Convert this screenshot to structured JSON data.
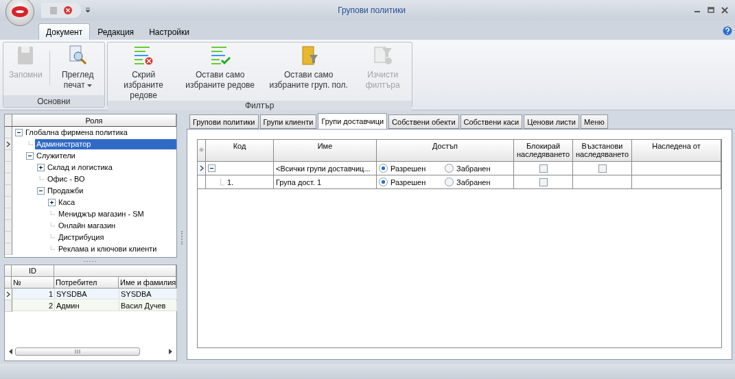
{
  "window": {
    "title": "Групови политики"
  },
  "ribbon_tabs": [
    {
      "label": "Документ",
      "selected": true
    },
    {
      "label": "Редакция",
      "selected": false
    },
    {
      "label": "Настройки",
      "selected": false
    }
  ],
  "ribbon_groups": [
    {
      "label": "Основни",
      "buttons": [
        {
          "kind": "save",
          "label": "Запомни",
          "disabled": true,
          "menu": false
        },
        {
          "kind": "preview",
          "label": "Преглед печат",
          "disabled": false,
          "menu": true
        }
      ]
    },
    {
      "label": "Филтър",
      "buttons": [
        {
          "kind": "hide-rows",
          "label": "Скрий избраните редове",
          "disabled": false,
          "menu": false
        },
        {
          "kind": "keep-rows",
          "label": "Остави само избраните редове",
          "disabled": false,
          "menu": false
        },
        {
          "kind": "keep-groups",
          "label": "Остави само избраните груп. пол.",
          "disabled": false,
          "menu": false
        },
        {
          "kind": "clear-filter",
          "label": "Изчисти филтъра",
          "disabled": true,
          "menu": false
        }
      ]
    }
  ],
  "roles": {
    "column": "Роля",
    "items": [
      {
        "label": "Глобална фирмена политика",
        "selected": false,
        "expanded": true,
        "children": [
          {
            "label": "Администратор",
            "selected": true
          },
          {
            "label": "Служители",
            "selected": false,
            "expanded": true,
            "children": [
              {
                "label": "Склад и логистика",
                "selected": false,
                "expanded": false
              },
              {
                "label": "Офис - ВО",
                "selected": false
              },
              {
                "label": "Продажби",
                "selected": false,
                "expanded": true,
                "children": [
                  {
                    "label": "Каса",
                    "selected": false,
                    "expanded": false
                  },
                  {
                    "label": "Мениджър магазин - SM",
                    "selected": false
                  },
                  {
                    "label": "Онлайн магазин",
                    "selected": false
                  },
                  {
                    "label": "Дистрибуция",
                    "selected": false
                  },
                  {
                    "label": "Реклама и ключови клиенти",
                    "selected": false
                  }
                ]
              }
            ]
          }
        ]
      }
    ]
  },
  "users": {
    "band": "ID",
    "columns": [
      "№",
      "Потребител",
      "Име и фамилия"
    ],
    "rows": [
      {
        "cells": [
          "1",
          "SYSDBA",
          "SYSDBA"
        ],
        "selected": true
      },
      {
        "cells": [
          "2",
          "Админ",
          "Васил Дучев"
        ],
        "selected": false
      }
    ]
  },
  "content_tabs": [
    {
      "label": "Групови политики",
      "selected": false
    },
    {
      "label": "Групи клиенти",
      "selected": false
    },
    {
      "label": "Групи доставчици",
      "selected": true
    },
    {
      "label": "Собствени обекти",
      "selected": false
    },
    {
      "label": "Собствени каси",
      "selected": false
    },
    {
      "label": "Ценови листи",
      "selected": false
    },
    {
      "label": "Меню",
      "selected": false
    }
  ],
  "grid": {
    "columns": [
      "Код",
      "Име",
      "Достъп",
      "Блокирай наследяването",
      "Възстанови наследяването",
      "Наследена от"
    ],
    "rows": [
      {
        "selected": true,
        "expanded": true,
        "code": "",
        "name": "<Всички групи доставчиц...",
        "access": [
          {
            "label": "Разрешен",
            "selected": true
          },
          {
            "label": "Забранен",
            "selected": false
          }
        ],
        "block": {
          "checked": false
        },
        "restore": {
          "checked": false
        }
      },
      {
        "selected": false,
        "code": "1.",
        "name": "Група дост. 1",
        "access": [
          {
            "label": "Разрешен",
            "selected": true
          },
          {
            "label": "Забранен",
            "selected": false
          }
        ],
        "block": {
          "checked": false
        }
      }
    ]
  }
}
